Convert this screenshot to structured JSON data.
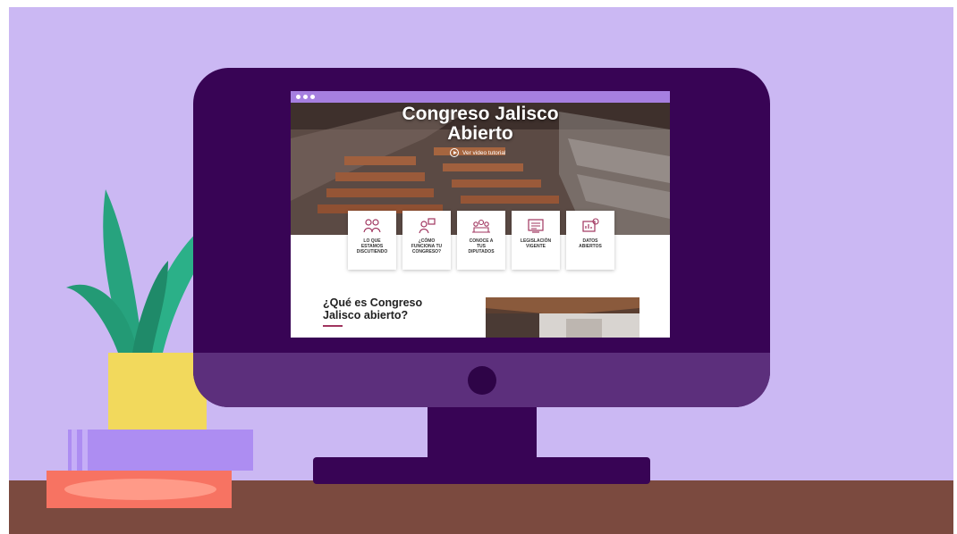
{
  "website": {
    "title_line1": "Congreso Jalisco",
    "title_line2": "Abierto",
    "tutorial_label": "Ver video tutorial",
    "cards": [
      {
        "label": "LO QUE\nESTAMOS\nDISCUTIENDO",
        "icon": "people-discussion-icon"
      },
      {
        "label": "¿CÓMO\nFUNCIONA TU\nCONGRESO?",
        "icon": "question-person-icon"
      },
      {
        "label": "CONOCE A\nTUS\nDIPUTADOS",
        "icon": "group-people-icon"
      },
      {
        "label": "LEGISLACIÓN\nVIGENTE",
        "icon": "law-document-icon"
      },
      {
        "label": "DATOS\nABIERTOS",
        "icon": "open-data-icon"
      }
    ],
    "section_title_line1": "¿Qué es Congreso",
    "section_title_line2": "Jalisco abierto?"
  },
  "colors": {
    "wall": "#cbb8f3",
    "desk": "#7b4a3f",
    "monitor": "#380455",
    "monitor_chin": "#5c2f7c",
    "browser_bar": "#a67fe0",
    "accent": "#a0355f",
    "pot": "#f2d95c",
    "leaves": "#27a37e"
  }
}
